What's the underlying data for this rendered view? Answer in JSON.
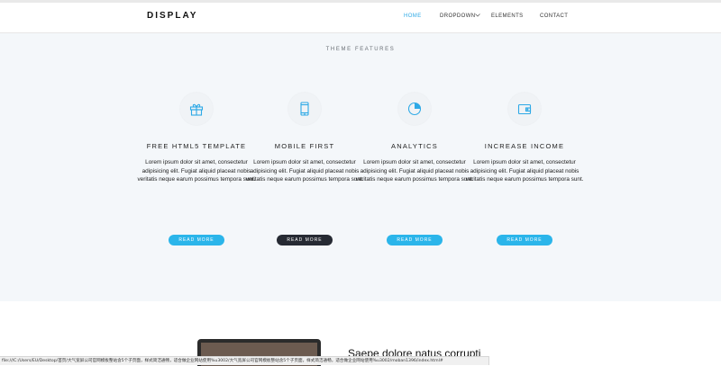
{
  "header": {
    "logo": "DISPLAY",
    "nav": [
      {
        "label": "HOME",
        "active": true
      },
      {
        "label": "DROPDOWN",
        "active": false
      },
      {
        "label": "ELEMENTS",
        "active": false
      },
      {
        "label": "CONTACT",
        "active": false
      }
    ]
  },
  "features_section": {
    "title": "THEME FEATURES",
    "items": [
      {
        "icon": "gift-icon",
        "title": "FREE HTML5 TEMPLATE",
        "text": "Lorem ipsum dolor sit amet, consectetur adipisicing elit. Fugiat aliquid placeat nobis veritatis neque earum possimus tempora sunt.",
        "button": "READ MORE",
        "button_style": "blue"
      },
      {
        "icon": "mobile-icon",
        "title": "MOBILE FIRST",
        "text": "Lorem ipsum dolor sit amet, consectetur adipisicing elit. Fugiat aliquid placeat nobis veritatis neque earum possimus tempora sunt.",
        "button": "READ MORE",
        "button_style": "dark"
      },
      {
        "icon": "pie-chart-icon",
        "title": "ANALYTICS",
        "text": "Lorem ipsum dolor sit amet, consectetur adipisicing elit. Fugiat aliquid placeat nobis veritatis neque earum possimus tempora sunt.",
        "button": "READ MORE",
        "button_style": "blue"
      },
      {
        "icon": "wallet-icon",
        "title": "INCREASE INCOME",
        "text": "Lorem ipsum dolor sit amet, consectetur adipisicing elit. Fugiat aliquid placeat nobis veritatis neque earum possimus tempora sunt.",
        "button": "READ MORE",
        "button_style": "blue"
      }
    ]
  },
  "bottom": {
    "heading": "Saepe dolore natus corrupti"
  },
  "status_bar": {
    "text": "file:///C:/Users/EU/Desktop/首页/大气宽屏公司官网模板整站含5个子页面，样式简洁通畅，适合做企业网站使用%u3002/大气宽屏公司官网模板整站含5个子页面，样式简洁通畅，适合做企业网站使用%u3002/moban1396/index.html#"
  },
  "colors": {
    "accent": "#2ea9e6",
    "button_blue": "#2bb5ea",
    "button_dark": "#262a33",
    "section_bg": "#f4f7fa"
  }
}
